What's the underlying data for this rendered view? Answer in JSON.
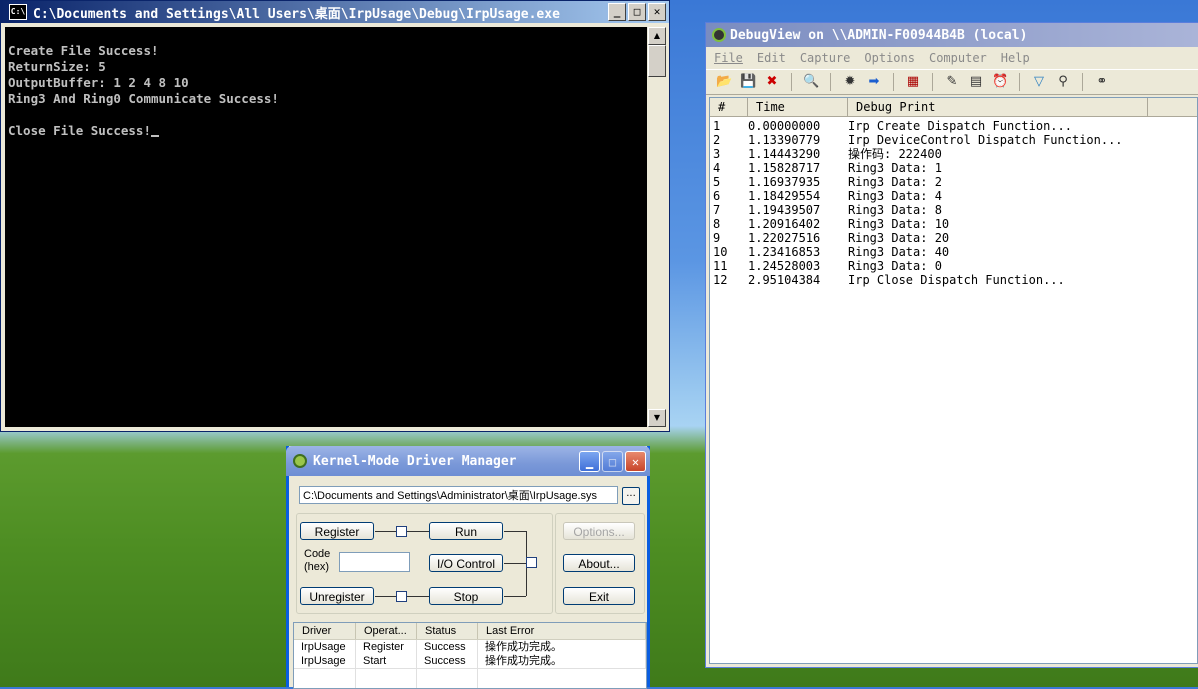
{
  "console": {
    "title": "C:\\Documents and Settings\\All Users\\桌面\\IrpUsage\\Debug\\IrpUsage.exe",
    "icon_label": "C:\\",
    "lines": [
      "Create File Success!",
      "ReturnSize: 5",
      "OutputBuffer: 1 2 4 8 10",
      "Ring3 And Ring0 Communicate Success!",
      "",
      "Close File Success!"
    ]
  },
  "debugview": {
    "title": "DebugView on \\\\ADMIN-F00944B4B (local)",
    "menu": [
      "File",
      "Edit",
      "Capture",
      "Options",
      "Computer",
      "Help"
    ],
    "columns": [
      "#",
      "Time",
      "Debug Print"
    ],
    "rows": [
      {
        "n": "1",
        "time": "0.00000000",
        "msg": "Irp Create Dispatch Function..."
      },
      {
        "n": "2",
        "time": "1.13390779",
        "msg": "Irp DeviceControl Dispatch Function..."
      },
      {
        "n": "3",
        "time": "1.14443290",
        "msg": "操作码: 222400"
      },
      {
        "n": "4",
        "time": "1.15828717",
        "msg": "Ring3 Data: 1"
      },
      {
        "n": "5",
        "time": "1.16937935",
        "msg": "Ring3 Data: 2"
      },
      {
        "n": "6",
        "time": "1.18429554",
        "msg": "Ring3 Data: 4"
      },
      {
        "n": "7",
        "time": "1.19439507",
        "msg": "Ring3 Data: 8"
      },
      {
        "n": "8",
        "time": "1.20916402",
        "msg": "Ring3 Data: 10"
      },
      {
        "n": "9",
        "time": "1.22027516",
        "msg": "Ring3 Data: 20"
      },
      {
        "n": "10",
        "time": "1.23416853",
        "msg": "Ring3 Data: 40"
      },
      {
        "n": "11",
        "time": "1.24528003",
        "msg": "Ring3 Data: 0"
      },
      {
        "n": "12",
        "time": "2.95104384",
        "msg": "Irp Close Dispatch Function..."
      }
    ]
  },
  "kmdm": {
    "title": "Kernel-Mode Driver Manager",
    "path": "C:\\Documents and Settings\\Administrator\\桌面\\IrpUsage.sys",
    "browse_label": "...",
    "buttons": {
      "register": "Register",
      "run": "Run",
      "io_control": "I/O Control",
      "unregister": "Unregister",
      "stop": "Stop",
      "options": "Options...",
      "about": "About...",
      "exit": "Exit"
    },
    "code_label_1": "Code",
    "code_label_2": "(hex)",
    "code_value": "",
    "columns": [
      "Driver",
      "Operat...",
      "Status",
      "Last Error"
    ],
    "rows": [
      {
        "driver": "IrpUsage",
        "op": "Register",
        "status": "Success",
        "error": "操作成功完成。"
      },
      {
        "driver": "IrpUsage",
        "op": "Start",
        "status": "Success",
        "error": "操作成功完成。"
      }
    ]
  }
}
